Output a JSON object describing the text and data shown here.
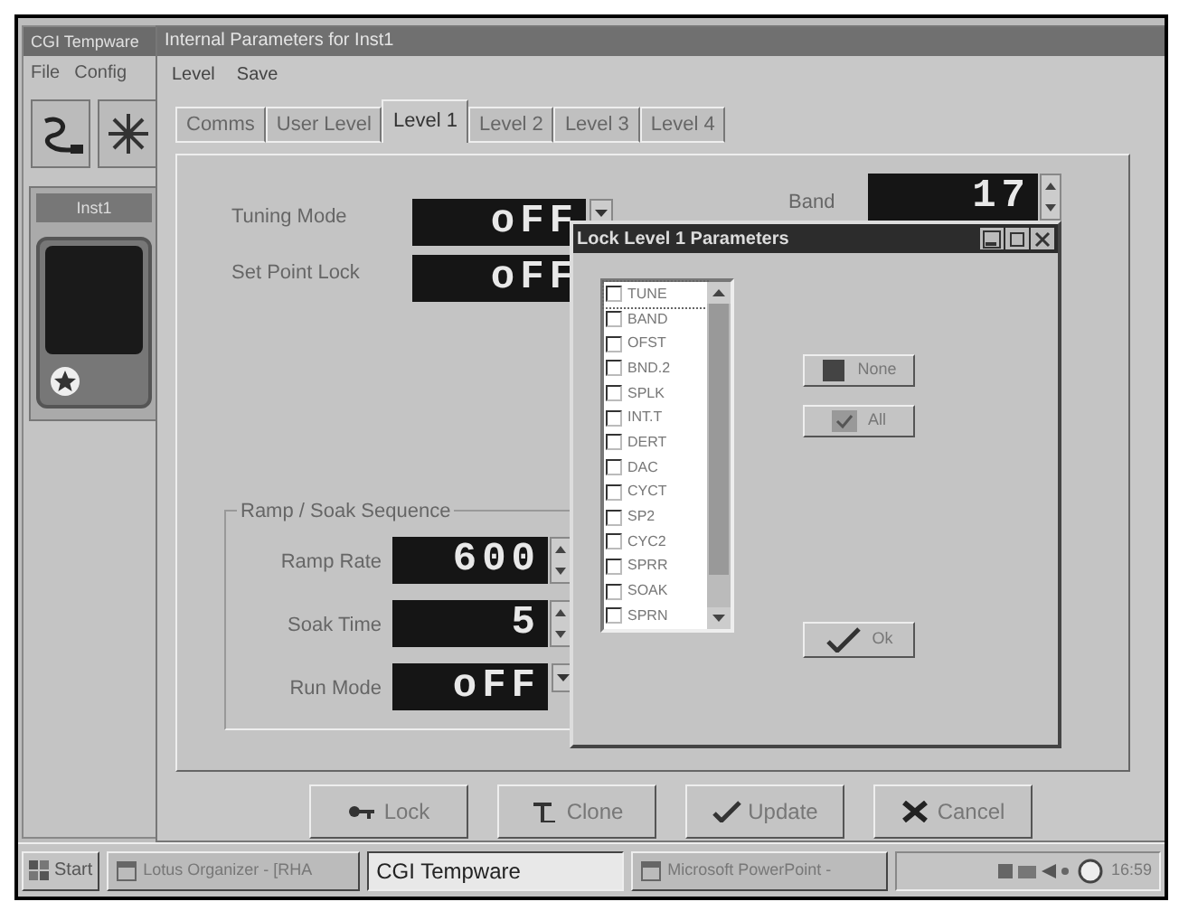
{
  "back_window": {
    "title": "CGI Tempware",
    "menu": [
      "File",
      "Config"
    ],
    "device_label": "Inst1"
  },
  "window": {
    "title": "Internal Parameters for Inst1",
    "menu": [
      "Level",
      "Save"
    ]
  },
  "tabs": [
    {
      "label": "Comms",
      "selected": false
    },
    {
      "label": "User Level",
      "selected": false
    },
    {
      "label": "Level 1",
      "selected": true
    },
    {
      "label": "Level 2",
      "selected": false
    },
    {
      "label": "Level 3",
      "selected": false
    },
    {
      "label": "Level 4",
      "selected": false
    }
  ],
  "fields": [
    {
      "label": "Tuning Mode",
      "value": "oFF",
      "kind": "dropdown"
    },
    {
      "label": "Set Point Lock",
      "value": "oFF",
      "kind": "plain"
    },
    {
      "label": "Band",
      "value": "17",
      "kind": "spinner"
    }
  ],
  "ramp_soak": {
    "title": "Ramp / Soak Sequence",
    "fields": [
      {
        "label": "Ramp Rate",
        "value": "600",
        "kind": "spinner"
      },
      {
        "label": "Soak Time",
        "value": "5",
        "kind": "spinner"
      },
      {
        "label": "Run Mode",
        "value": "oFF",
        "kind": "dropdown"
      }
    ]
  },
  "dialog": {
    "title": "Lock Level 1 Parameters",
    "items": [
      {
        "label": "TUNE",
        "checked": false,
        "selected": true
      },
      {
        "label": "BAND",
        "checked": false,
        "selected": false
      },
      {
        "label": "OFST",
        "checked": false,
        "selected": false
      },
      {
        "label": "BND.2",
        "checked": false,
        "selected": false
      },
      {
        "label": "SPLK",
        "checked": false,
        "selected": false
      },
      {
        "label": "INT.T",
        "checked": false,
        "selected": false
      },
      {
        "label": "DERT",
        "checked": false,
        "selected": false
      },
      {
        "label": "DAC",
        "checked": false,
        "selected": false
      },
      {
        "label": "CYCT",
        "checked": false,
        "selected": false
      },
      {
        "label": "SP2",
        "checked": false,
        "selected": false
      },
      {
        "label": "CYC2",
        "checked": false,
        "selected": false
      },
      {
        "label": "SPRR",
        "checked": false,
        "selected": false
      },
      {
        "label": "SOAK",
        "checked": false,
        "selected": false
      },
      {
        "label": "SPRN",
        "checked": false,
        "selected": false
      }
    ],
    "buttons": [
      {
        "label": "None",
        "kind": "none"
      },
      {
        "label": "All",
        "kind": "all"
      },
      {
        "label": "Ok",
        "kind": "ok"
      }
    ]
  },
  "buttons": [
    {
      "label": "Lock",
      "kind": "lock"
    },
    {
      "label": "Clone",
      "kind": "clone"
    },
    {
      "label": "Update",
      "kind": "update"
    },
    {
      "label": "Cancel",
      "kind": "cancel"
    }
  ],
  "taskbar": {
    "start": "Start",
    "tasks": [
      {
        "label": "Lotus Organizer - [RHA",
        "selected": false
      },
      {
        "label": "CGI Tempware",
        "selected": true
      },
      {
        "label": "Microsoft PowerPoint -",
        "selected": false
      }
    ],
    "clock": "16:59"
  }
}
